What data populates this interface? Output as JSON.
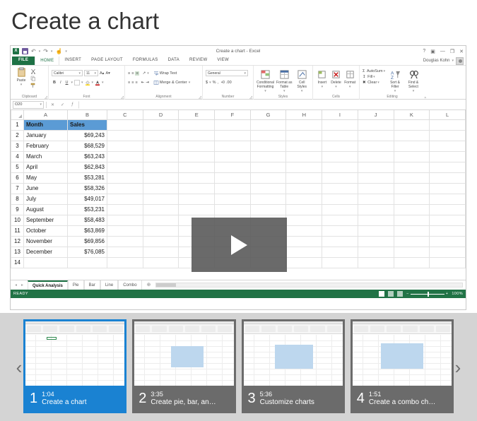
{
  "page": {
    "title": "Create a chart"
  },
  "excel": {
    "title_bar": {
      "window_title": "Create a chart - Excel",
      "quick_access": [
        {
          "name": "excel-logo-icon",
          "label": "X"
        },
        {
          "name": "save-icon",
          "label": ""
        },
        {
          "name": "undo-icon",
          "label": "↶"
        },
        {
          "name": "redo-icon",
          "label": "↷"
        },
        {
          "name": "touch-mode-icon",
          "label": "☝"
        },
        {
          "name": "customize-qat-icon",
          "label": "▾"
        }
      ],
      "window_controls": [
        {
          "name": "help-button",
          "label": "?"
        },
        {
          "name": "ribbon-display-options-button",
          "label": "▣"
        },
        {
          "name": "minimize-button",
          "label": "—"
        },
        {
          "name": "restore-button",
          "label": "❐"
        },
        {
          "name": "close-button",
          "label": "✕"
        }
      ],
      "user_name": "Douglas Kohn",
      "user_caret": "▾"
    },
    "ribbon_tabs": [
      "FILE",
      "HOME",
      "INSERT",
      "PAGE LAYOUT",
      "FORMULAS",
      "DATA",
      "REVIEW",
      "VIEW"
    ],
    "active_tab": "HOME",
    "ribbon_groups": [
      {
        "label": "Clipboard",
        "big_button": "Paste",
        "items": [
          "Cut",
          "Copy",
          "Format Painter"
        ]
      },
      {
        "label": "Font",
        "font_name": "Calibri",
        "font_size": "11",
        "items": [
          "Increase Font Size",
          "Decrease Font Size",
          "Bold",
          "Italic",
          "Underline",
          "Borders",
          "Fill Color",
          "Font Color"
        ]
      },
      {
        "label": "Alignment",
        "items": [
          "Top Align",
          "Middle Align",
          "Bottom Align",
          "Orientation",
          "Wrap Text",
          "Align Left",
          "Center",
          "Align Right",
          "Decrease Indent",
          "Increase Indent",
          "Merge & Center"
        ],
        "wrap_text": "Wrap Text",
        "merge_center": "Merge & Center"
      },
      {
        "label": "Number",
        "format": "General",
        "items": [
          "Accounting Number Format",
          "Percent Style",
          "Comma Style",
          "Increase Decimal",
          "Decrease Decimal"
        ]
      },
      {
        "label": "Styles",
        "buttons": [
          "Conditional Formatting",
          "Format as Table",
          "Cell Styles"
        ]
      },
      {
        "label": "Cells",
        "buttons": [
          "Insert",
          "Delete",
          "Format"
        ]
      },
      {
        "label": "Editing",
        "buttons": [
          "AutoSum",
          "Fill",
          "Clear",
          "Sort & Filter",
          "Find & Select"
        ]
      }
    ],
    "formula_bar": {
      "name_box": "O20",
      "name_box_caret": "▾",
      "cancel": "✕",
      "enter": "✓",
      "function": "ƒ",
      "value": ""
    },
    "grid": {
      "columns": [
        "A",
        "B",
        "C",
        "D",
        "E",
        "F",
        "G",
        "H",
        "I",
        "J",
        "K",
        "L"
      ],
      "rows": [
        {
          "num": "1",
          "a": "Month",
          "b": "Sales",
          "header": true
        },
        {
          "num": "2",
          "a": "January",
          "b": "$69,243"
        },
        {
          "num": "3",
          "a": "February",
          "b": "$68,529"
        },
        {
          "num": "4",
          "a": "March",
          "b": "$63,243"
        },
        {
          "num": "5",
          "a": "April",
          "b": "$62,843"
        },
        {
          "num": "6",
          "a": "May",
          "b": "$53,281"
        },
        {
          "num": "7",
          "a": "June",
          "b": "$58,326"
        },
        {
          "num": "8",
          "a": "July",
          "b": "$49,017"
        },
        {
          "num": "9",
          "a": "August",
          "b": "$53,231"
        },
        {
          "num": "10",
          "a": "September",
          "b": "$58,483"
        },
        {
          "num": "11",
          "a": "October",
          "b": "$63,869"
        },
        {
          "num": "12",
          "a": "November",
          "b": "$69,856"
        },
        {
          "num": "13",
          "a": "December",
          "b": "$76,085"
        },
        {
          "num": "14",
          "a": "",
          "b": ""
        }
      ],
      "header_fill": "#5b9bd5"
    },
    "video_overlay": {
      "play_icon": "play-triangle-icon"
    },
    "sheet_tabs": [
      {
        "label": "Quick Analysis",
        "active": true
      },
      {
        "label": "Pie",
        "active": false
      },
      {
        "label": "Bar",
        "active": false
      },
      {
        "label": "Line",
        "active": false
      },
      {
        "label": "Combo",
        "active": false
      }
    ],
    "add_sheet_label": "⊕",
    "sheet_nav": {
      "prev": "◂",
      "next": "▸"
    },
    "status_bar": {
      "mode": "READY",
      "views": [
        "Normal",
        "Page Layout",
        "Page Break Preview"
      ],
      "zoom_out": "−",
      "zoom_in": "+",
      "zoom_level": "100%"
    }
  },
  "carousel": {
    "prev_arrow": "‹",
    "next_arrow": "›",
    "thumbnails": [
      {
        "number": "1",
        "time": "1:04",
        "name": "Create a chart",
        "selected": true
      },
      {
        "number": "2",
        "time": "3:35",
        "name": "Create pie, bar, an…",
        "selected": false
      },
      {
        "number": "3",
        "time": "5:36",
        "name": "Customize charts",
        "selected": false
      },
      {
        "number": "4",
        "time": "1:51",
        "name": "Create a combo ch…",
        "selected": false
      }
    ],
    "selected_color": "#1a82d2",
    "background": "#d4d4d4"
  }
}
